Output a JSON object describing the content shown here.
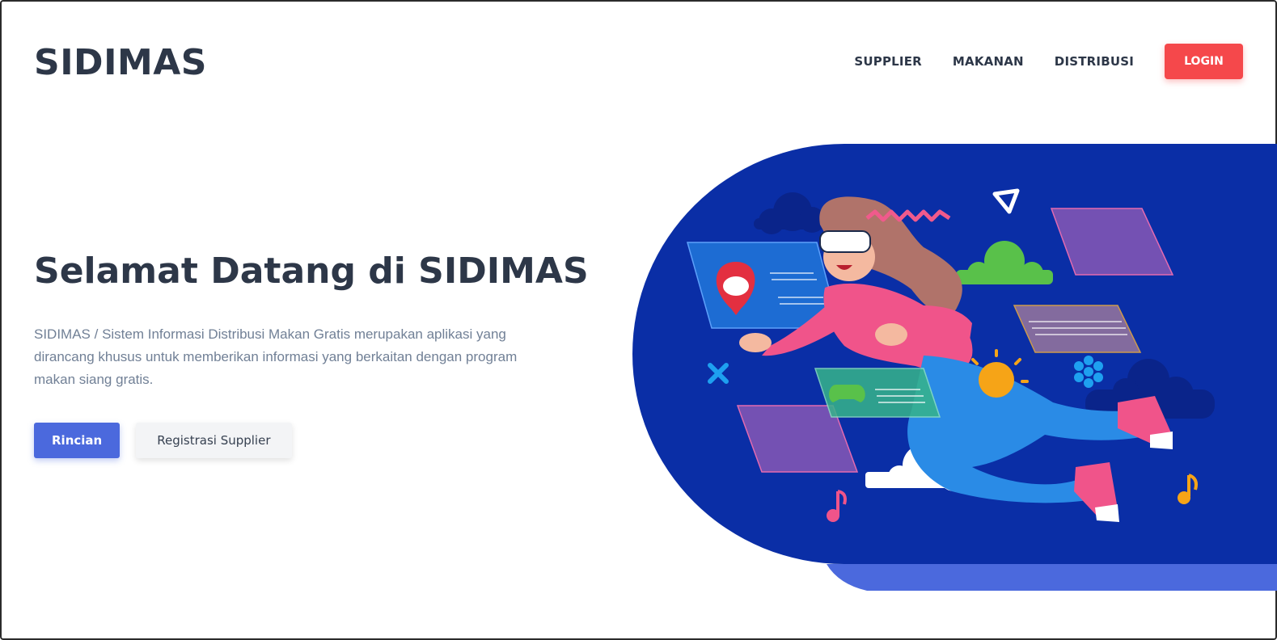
{
  "header": {
    "logo": "SIDIMAS",
    "nav": [
      "SUPPLIER",
      "MAKANAN",
      "DISTRIBUSI"
    ],
    "login_label": "LOGIN"
  },
  "hero": {
    "title": "Selamat Datang di SIDIMAS",
    "description": "SIDIMAS / Sistem Informasi Distribusi Makan Gratis merupakan aplikasi yang dirancang khusus untuk memberikan informasi yang berkaitan dengan program makan siang gratis.",
    "primary_button": "Rincian",
    "secondary_button": "Registrasi Supplier"
  },
  "colors": {
    "accent_red": "#f5484b",
    "primary_blue": "#4b69dd",
    "hero_bg": "#0a2ea6",
    "text_dark": "#2d3748",
    "text_muted": "#718096"
  }
}
